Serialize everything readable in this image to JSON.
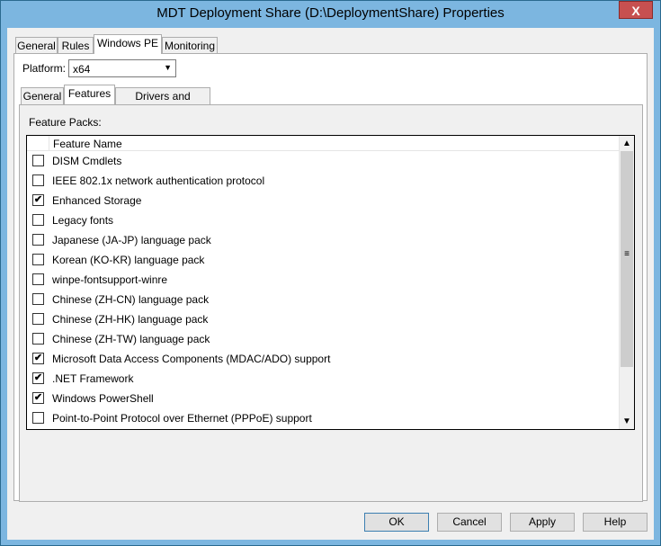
{
  "window": {
    "title": "MDT Deployment Share (D:\\DeploymentShare) Properties",
    "close": "X"
  },
  "outer_tabs": [
    "General",
    "Rules",
    "Windows PE",
    "Monitoring"
  ],
  "platform": {
    "label": "Platform:",
    "value": "x64",
    "arrow": "▼"
  },
  "inner_tabs": [
    "General",
    "Features",
    "Drivers and Patches"
  ],
  "feature_packs": {
    "label": "Feature Packs:",
    "column_header": "Feature Name",
    "items": [
      {
        "name": "DISM Cmdlets",
        "checked": false
      },
      {
        "name": "IEEE 802.1x network authentication protocol",
        "checked": false
      },
      {
        "name": "Enhanced Storage",
        "checked": true
      },
      {
        "name": "Legacy fonts",
        "checked": false
      },
      {
        "name": "Japanese (JA-JP) language pack",
        "checked": false
      },
      {
        "name": "Korean (KO-KR) language pack",
        "checked": false
      },
      {
        "name": "winpe-fontsupport-winre",
        "checked": false
      },
      {
        "name": "Chinese (ZH-CN) language pack",
        "checked": false
      },
      {
        "name": "Chinese (ZH-HK) language pack",
        "checked": false
      },
      {
        "name": "Chinese (ZH-TW) language pack",
        "checked": false
      },
      {
        "name": "Microsoft Data Access Components (MDAC/ADO) support",
        "checked": true
      },
      {
        "name": ".NET Framework",
        "checked": true
      },
      {
        "name": "Windows PowerShell",
        "checked": true
      },
      {
        "name": "Point-to-Point Protocol over Ethernet (PPPoE) support",
        "checked": false
      }
    ]
  },
  "scrollbar": {
    "up": "▲",
    "down": "▼",
    "grip": "≡"
  },
  "buttons": {
    "ok": "OK",
    "cancel": "Cancel",
    "apply": "Apply",
    "help": "Help"
  },
  "check_glyph": "✔"
}
